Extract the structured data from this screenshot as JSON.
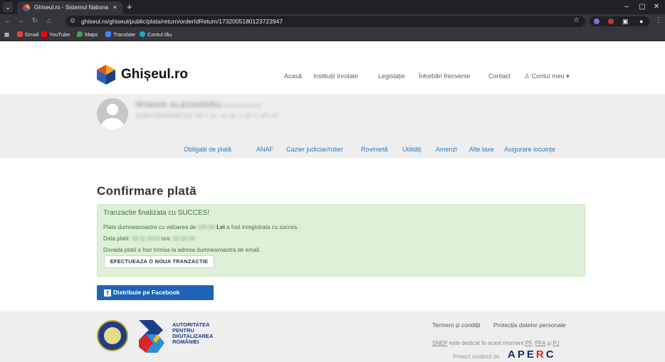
{
  "browser": {
    "tab_title": "Ghiseul.ro - Sistemul National E",
    "tab_close": "×",
    "new_tab": "+",
    "url": "ghiseul.ro/ghiseul/public/plata/return/orderIdReturn/1732005180123723947",
    "window_controls": [
      "–",
      "▢",
      "✕"
    ],
    "nav_icons": [
      "arrow-left-icon",
      "arrow-right-icon",
      "reload-icon",
      "home-icon"
    ],
    "bookmarks": [
      "Gmail",
      "YouTube",
      "Maps",
      "Translate",
      "Contul tău"
    ],
    "colors": {
      "chrome_dark": "#202124",
      "chrome_mid": "#35363a"
    }
  },
  "site": {
    "logo_text": "Ghișeul.ro",
    "nav": [
      "Acasă",
      "Instituții înrolate",
      "Legislație",
      "Întrebări frecvente",
      "Contact"
    ],
    "account_label": "Contul meu",
    "profile": {
      "name": "ROMAN ALEXANDRU",
      "name_extra": "XXXXXXXXXX",
      "address": "ALEEA STRATEGIE XXX, NR. X, BL. XX, SC. X, ET. X, APT. XX"
    },
    "tabs": [
      "Obligații de plată",
      "ANAF",
      "Cazier judiciar/rutier",
      "Rovinietă",
      "Utilități",
      "Amenzi",
      "Alte taxe",
      "Asigurare locuințe"
    ],
    "colors": {
      "link": "#2a7ac0",
      "success_bg": "#dff0d8",
      "success_text": "#3c763d",
      "facebook": "#1e63b7"
    }
  },
  "main": {
    "title": "Confirmare plată",
    "alert": {
      "title": "Tranzactie finalizata cu SUCCES!",
      "line1_prefix": "Plata dumneavoastra cu valoarea de",
      "amount": "100.00",
      "currency": "Lei",
      "line1_suffix": "a fost inregistrata cu succes.",
      "date_label": "Data platii:",
      "date": "19.11.2024",
      "time_label": "ora:",
      "time": "10:28:44",
      "email_note": "Dovada platii a fost trimisa la adresa dumneavoastra de email.",
      "new_tx_button": "EFECTUEAZA O NOUA TRANZACTIE"
    },
    "facebook_button": "Distribuie pe Facebook"
  },
  "footer": {
    "adr_text": [
      "AUTORITATEA",
      "PENTRU",
      "DIGITALIZAREA",
      "ROMÂNIEI"
    ],
    "links": [
      "Termeni și condiții",
      "Protecția datelor personale"
    ],
    "snep_prefix": "SNEP",
    "snep_text": "este dedicat în acest moment",
    "snep_pf": "PF",
    "snep_pfa": "PFA",
    "snep_and": "și",
    "snep_pj": "PJ",
    "supported": "Proiect susținut de",
    "aperc": "APERC"
  }
}
